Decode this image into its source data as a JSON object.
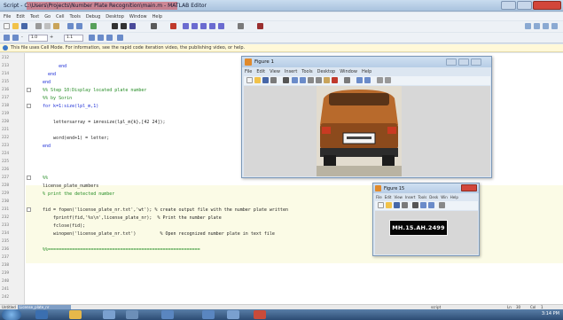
{
  "window": {
    "title": "Script - C:\\Users\\Projects\\Number Plate Recognition\\main.m - MATLAB Editor",
    "accent": "#d2463a"
  },
  "menubar": {
    "items": [
      "File",
      "Edit",
      "Text",
      "Go",
      "Cell",
      "Tools",
      "Debug",
      "Desktop",
      "Window",
      "Help"
    ]
  },
  "toolbar2": {
    "zoom_a": "1.0",
    "zoom_b": "1.1"
  },
  "infobar": {
    "text": "This file uses Cell Mode. For information, see the rapid code iteration video, the publishing video, or help."
  },
  "editor": {
    "lines": [
      {
        "num": "212",
        "text": "",
        "cls": ""
      },
      {
        "num": "213",
        "text": "        end",
        "cls": "kw"
      },
      {
        "num": "214",
        "text": "    end",
        "cls": "kw"
      },
      {
        "num": "215",
        "text": "  end",
        "cls": "kw"
      },
      {
        "num": "216",
        "text": "  %% Step 10:Display located plate number",
        "cls": "cm"
      },
      {
        "num": "217",
        "text": "  %% by Sorin",
        "cls": "cm"
      },
      {
        "num": "218",
        "text": "  for k=1:size(lpl_m,1)",
        "cls": "kw"
      },
      {
        "num": "219",
        "text": "",
        "cls": ""
      },
      {
        "num": "220",
        "text": "      lettersarray = imresize(lpl_m{k},[42 24]);",
        "cls": ""
      },
      {
        "num": "221",
        "text": "",
        "cls": ""
      },
      {
        "num": "222",
        "text": "      word(end+1) = letter;",
        "cls": ""
      },
      {
        "num": "223",
        "text": "  end",
        "cls": "kw"
      },
      {
        "num": "224",
        "text": "",
        "cls": ""
      },
      {
        "num": "225",
        "text": "",
        "cls": ""
      },
      {
        "num": "226",
        "text": "",
        "cls": ""
      },
      {
        "num": "227",
        "text": "  %%",
        "cls": "cm"
      },
      {
        "num": "228",
        "text": "  license_plate_numbers",
        "cls": ""
      },
      {
        "num": "229",
        "text": "  % print the detected number",
        "cls": "cm"
      },
      {
        "num": "230",
        "text": "",
        "cls": ""
      },
      {
        "num": "231",
        "text": "  fid = fopen('license_plate_nr.txt','wt'); % create output file with the number plate written",
        "cls": ""
      },
      {
        "num": "232",
        "text": "      fprintf(fid,'%s\\n',license_plate_nr);  % Print the number plate",
        "cls": ""
      },
      {
        "num": "233",
        "text": "      fclose(fid);",
        "cls": ""
      },
      {
        "num": "234",
        "text": "      winopen('license_plate_nr.txt')         % Open recognized number plate in text file",
        "cls": ""
      },
      {
        "num": "235",
        "text": "",
        "cls": ""
      },
      {
        "num": "236",
        "text": "  %%=========================================================",
        "cls": "cm"
      },
      {
        "num": "237",
        "text": "",
        "cls": ""
      },
      {
        "num": "238",
        "text": "",
        "cls": ""
      },
      {
        "num": "239",
        "text": "",
        "cls": ""
      },
      {
        "num": "240",
        "text": "",
        "cls": ""
      },
      {
        "num": "241",
        "text": "",
        "cls": ""
      },
      {
        "num": "242",
        "text": "",
        "cls": ""
      }
    ]
  },
  "figure1": {
    "title": "Figure 1",
    "menus": [
      "File",
      "Edit",
      "View",
      "Insert",
      "Tools",
      "Desktop",
      "Window",
      "Help"
    ]
  },
  "figure2": {
    "title": "Figure 15",
    "menus": [
      "File",
      "Edit",
      "View",
      "Insert",
      "Tools",
      "Desk",
      "Win",
      "Help"
    ],
    "plate_text": "MH.15.AH.2499"
  },
  "statusbar": {
    "script_label": "Untitled",
    "tab": "License_plate_nr",
    "ln": "Ln",
    "ln_val": "30",
    "col": "Col",
    "col_val": "1",
    "mode": "script"
  },
  "taskbar": {
    "clock": "3:14 PM"
  }
}
